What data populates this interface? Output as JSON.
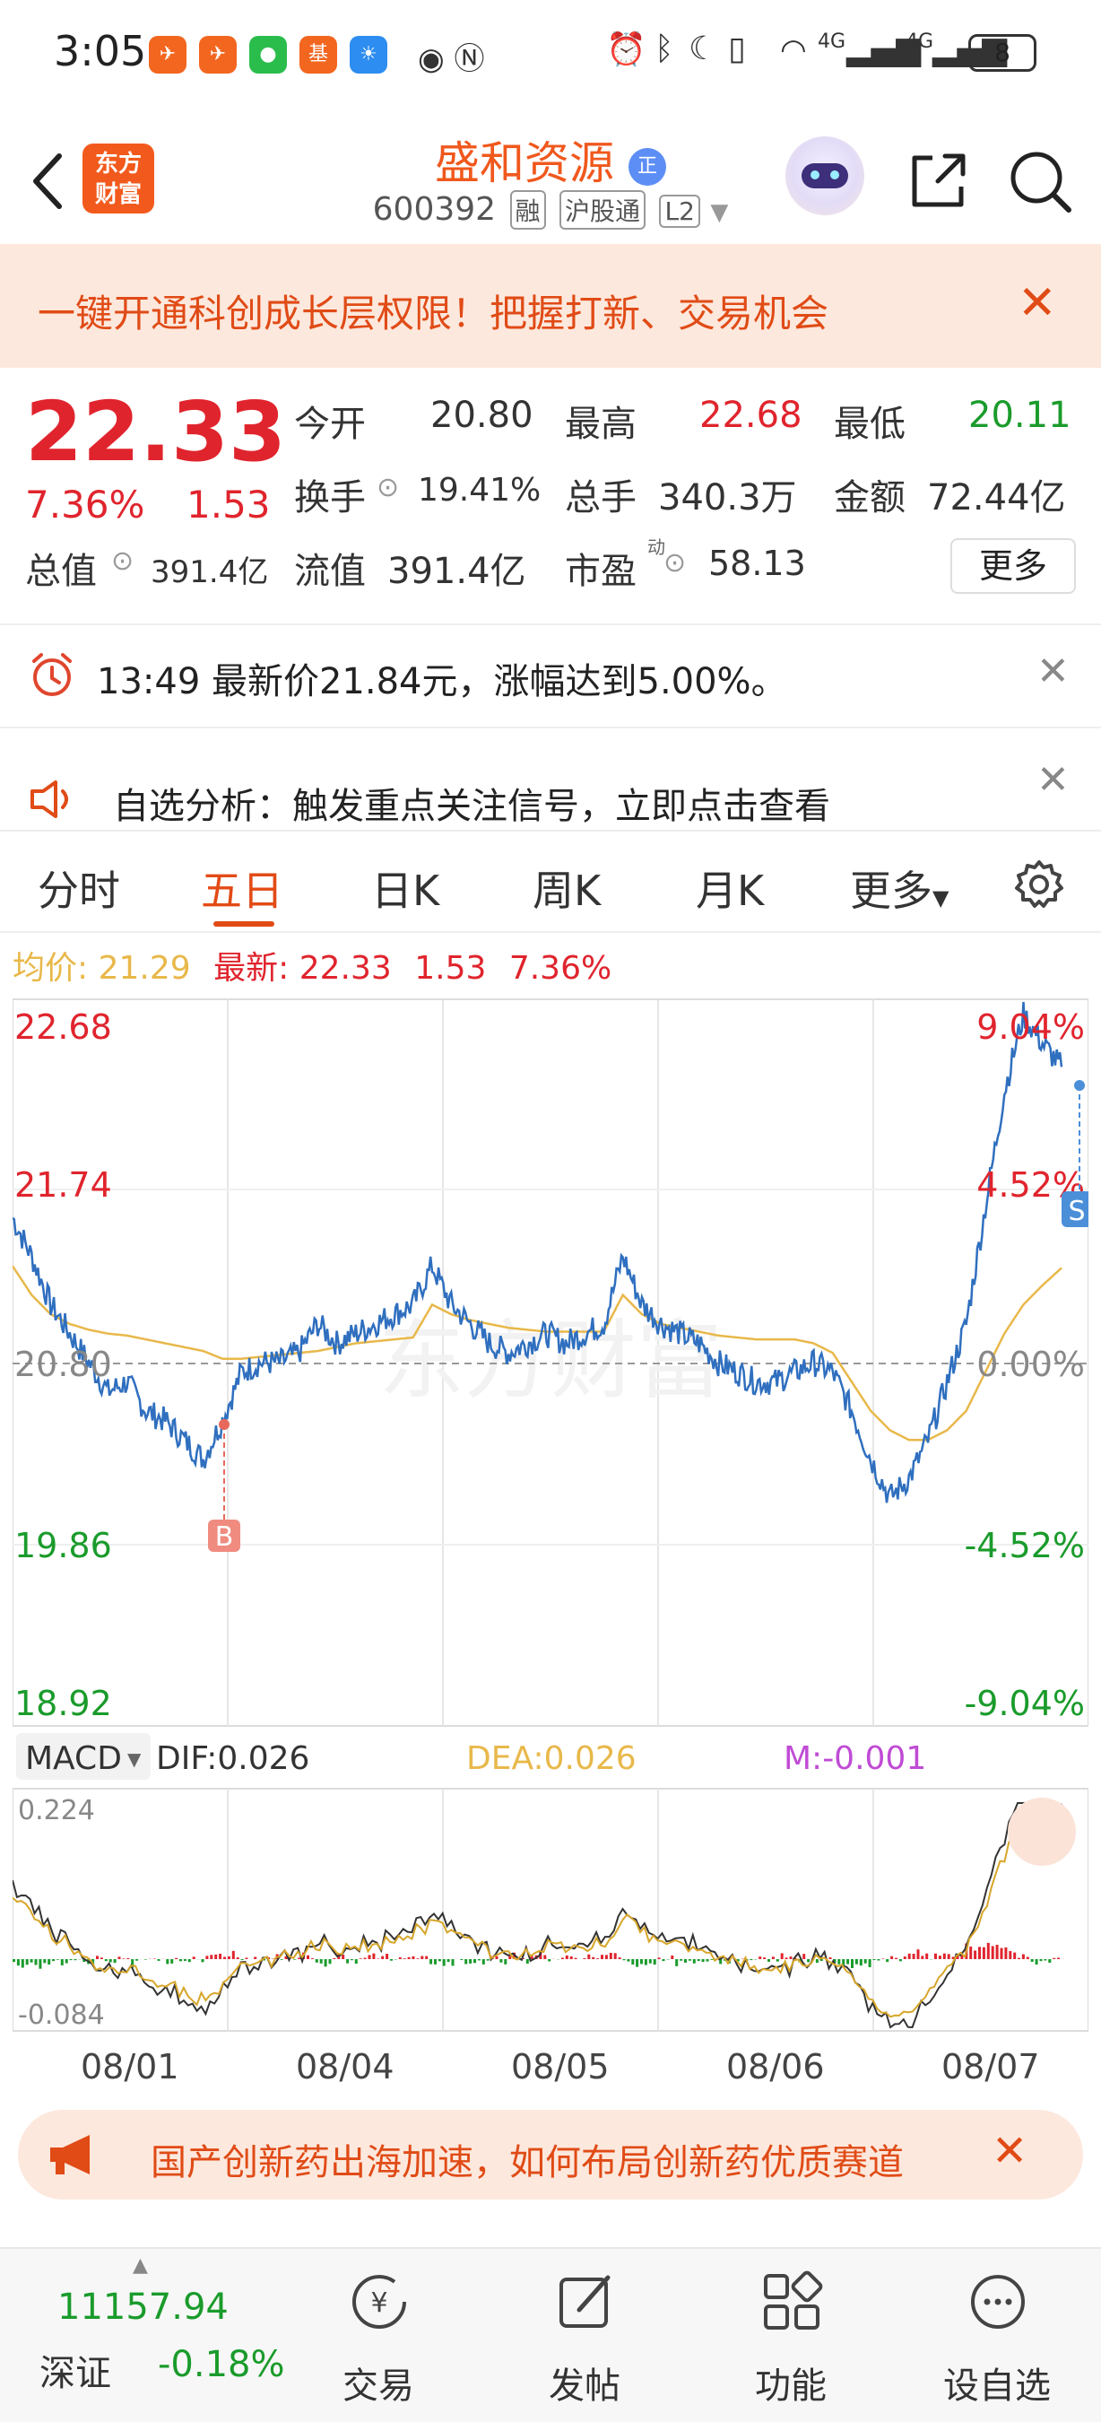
{
  "status_bar": {
    "time": "3:05",
    "network": "4G",
    "battery": "8"
  },
  "header": {
    "logo_text_top": "东方",
    "logo_text_bottom": "财富",
    "stock_name": "盛和资源",
    "name_badge": "正",
    "stock_code": "600392",
    "tags": [
      "融",
      "沪股通",
      "L2"
    ]
  },
  "promo": {
    "text": "一键开通科创成长层权限！把握打新、交易机会"
  },
  "quote": {
    "price": "22.33",
    "change_pct": "7.36%",
    "change": "1.53",
    "total_value_label": "总值",
    "total_value": "391.4亿",
    "open_label": "今开",
    "open": "20.80",
    "high_label": "最高",
    "high": "22.68",
    "low_label": "最低",
    "low": "20.11",
    "turnover_label": "换手",
    "turnover": "19.41%",
    "volume_label": "总手",
    "volume": "340.3万",
    "amount_label": "金额",
    "amount": "72.44亿",
    "float_value_label": "流值",
    "float_value": "391.4亿",
    "pe_label": "市盈",
    "pe_sup": "动",
    "pe": "58.13",
    "more_label": "更多"
  },
  "alerts": {
    "price_alert": "13:49 最新价21.84元，涨幅达到5.00%。",
    "analysis": "自选分析：触发重点关注信号，立即点击查看"
  },
  "tabs": [
    "分时",
    "五日",
    "日K",
    "周K",
    "月K",
    "更多"
  ],
  "active_tab": "五日",
  "infoline": {
    "avg_label": "均价:",
    "avg": "21.29",
    "latest_label": "最新:",
    "latest": "22.33",
    "change": "1.53",
    "change_pct": "7.36%"
  },
  "chart_data": {
    "type": "line",
    "x_labels": [
      "08/01",
      "08/04",
      "08/05",
      "08/06",
      "08/07"
    ],
    "y_left": [
      "22.68",
      "21.74",
      "20.80",
      "19.86",
      "18.92"
    ],
    "y_right": [
      "9.04%",
      "4.52%",
      "0.00%",
      "-4.52%",
      "-9.04%"
    ],
    "ylim": [
      18.92,
      22.68
    ],
    "baseline": 20.8,
    "series": [
      {
        "name": "",
        "color": "#2f6fbf",
        "values": [
          21.55,
          21.35,
          21.1,
          20.95,
          20.8,
          20.65,
          20.7,
          20.55,
          20.5,
          20.4,
          20.3,
          20.5,
          20.75,
          20.8,
          20.8,
          20.85,
          21.0,
          20.9,
          20.95,
          21.0,
          21.05,
          21.1,
          21.3,
          21.1,
          21.0,
          20.9,
          20.85,
          20.9,
          20.95,
          20.9,
          20.95,
          21.0,
          21.35,
          21.1,
          21.0,
          20.95,
          20.9,
          20.8,
          20.75,
          20.7,
          20.7,
          20.75,
          20.8,
          20.75,
          20.55,
          20.3,
          20.1,
          20.2,
          20.4,
          20.7,
          21.0,
          21.6,
          22.2,
          22.6,
          22.45,
          22.33
        ]
      },
      {
        "name": "",
        "color": "#e8b84a",
        "values": [
          21.3,
          21.15,
          21.05,
          21.0,
          20.97,
          20.95,
          20.94,
          20.92,
          20.9,
          20.88,
          20.86,
          20.82,
          20.82,
          20.83,
          20.84,
          20.85,
          20.86,
          20.88,
          20.9,
          20.91,
          20.92,
          20.93,
          21.1,
          21.05,
          21.02,
          21.0,
          20.98,
          20.97,
          20.96,
          20.96,
          20.96,
          20.96,
          21.15,
          21.05,
          21.0,
          20.98,
          20.96,
          20.94,
          20.93,
          20.92,
          20.92,
          20.92,
          20.9,
          20.85,
          20.7,
          20.55,
          20.45,
          20.4,
          20.4,
          20.45,
          20.55,
          20.75,
          20.95,
          21.1,
          21.2,
          21.29
        ]
      }
    ],
    "markers": [
      {
        "label": "B",
        "at_value": 20.3,
        "color": "#e8685c"
      },
      {
        "label": "S",
        "at_value": 22.45,
        "color": "#4b8fd9"
      }
    ],
    "watermark": "东方财富"
  },
  "macd": {
    "selector_label": "MACD",
    "dif_label": "DIF:0.026",
    "dea_label": "DEA:0.026",
    "m_label": "M:-0.001",
    "max_label": "0.224",
    "min_label": "-0.084"
  },
  "ad_banner": {
    "text": "国产创新药出海加速，如何布局创新药优质赛道"
  },
  "bottom_nav": {
    "index_value": "11157.94",
    "index_name": "深证",
    "index_change": "-0.18%",
    "items": [
      "交易",
      "发帖",
      "功能",
      "设自选"
    ]
  }
}
